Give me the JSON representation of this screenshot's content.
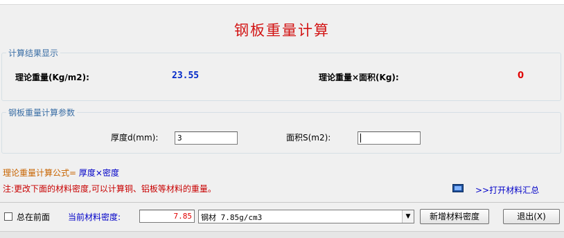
{
  "title": "钢板重量计算",
  "results": {
    "legend": "计算结果显示",
    "theory_weight_label": "理论重量(Kg/m2):",
    "theory_weight_value": "23.55",
    "weight_area_label": "理论重量×面积(Kg):",
    "weight_area_value": "0"
  },
  "params": {
    "legend": "钢板重量计算参数",
    "thickness_label": "厚度d(mm):",
    "thickness_value": "3",
    "area_label": "面积S(m2):",
    "area_value": ""
  },
  "formula": {
    "label": "理论重量计算公式=",
    "expr": "厚度×密度"
  },
  "note": "注:更改下面的材料密度,可以计算铜、铝板等材料的重量。",
  "open_summary_link": ">>打开材料汇总",
  "bottom": {
    "always_on_top_label": "总在前面",
    "density_label": "当前材料密度:",
    "density_value": "7.85",
    "material_selected": "钢材 7.85g/cm3",
    "add_density_button": "新增材料密度",
    "exit_button": "退出(X)"
  },
  "colors": {
    "title": "#d21414",
    "legend": "#3a6ea5",
    "value_blue": "#0028c8",
    "value_red": "#e00000",
    "formula_orange": "#c86400",
    "formula_blue": "#0000c8",
    "note_red": "#c80000"
  },
  "icons": {
    "summary": "table-icon",
    "dropdown": "chevron-down-icon"
  }
}
